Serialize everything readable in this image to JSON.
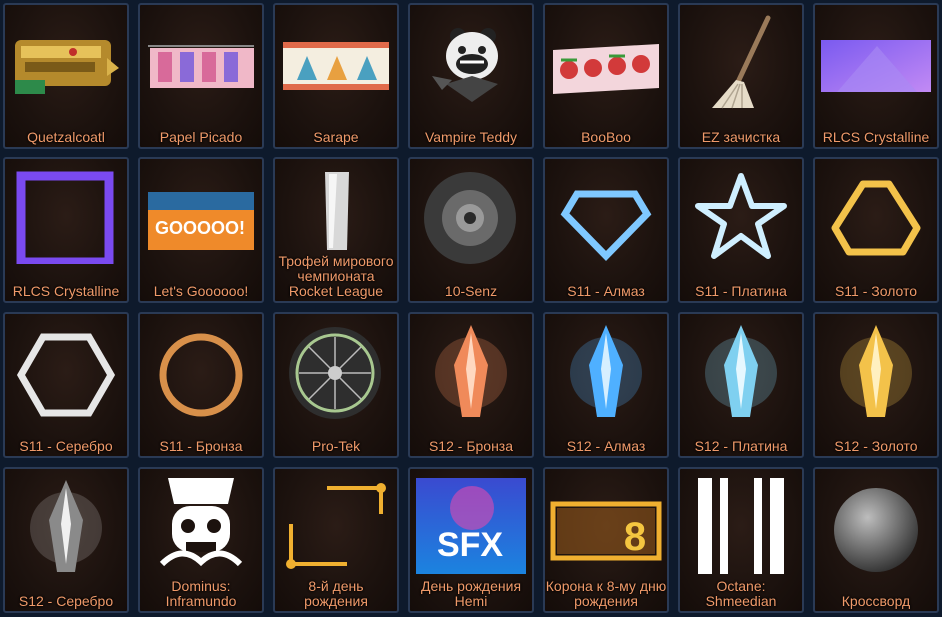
{
  "items": [
    {
      "name": "Quetzalcoatl",
      "icon": "quetzalcoatl-topper-icon"
    },
    {
      "name": "Papel Picado",
      "icon": "papel-picado-flag-icon"
    },
    {
      "name": "Sarape",
      "icon": "sarape-flag-icon"
    },
    {
      "name": "Vampire Teddy",
      "icon": "vampire-teddy-topper-icon"
    },
    {
      "name": "BooBoo",
      "icon": "booboo-banner-icon"
    },
    {
      "name": "EZ зачистка",
      "icon": "broom-icon"
    },
    {
      "name": "RLCS Crystalline",
      "icon": "crystalline-banner-icon"
    },
    {
      "name": "RLCS Crystalline",
      "icon": "crystalline-border-icon"
    },
    {
      "name": "Let's Goooooo!",
      "icon": "lets-go-banner-icon"
    },
    {
      "name": "Трофей мирового чемпионата Rocket League",
      "icon": "trophy-icon"
    },
    {
      "name": "10-Senz",
      "icon": "wheel-icon"
    },
    {
      "name": "S11 - Алмаз",
      "icon": "diamond-rank-icon"
    },
    {
      "name": "S11 - Платина",
      "icon": "star-rank-icon"
    },
    {
      "name": "S11 - Золото",
      "icon": "triangle-rank-icon"
    },
    {
      "name": "S11 - Серебро",
      "icon": "hexagon-rank-icon"
    },
    {
      "name": "S11 - Бронза",
      "icon": "circle-rank-icon"
    },
    {
      "name": "Pro-Tek",
      "icon": "spoke-wheel-icon"
    },
    {
      "name": "S12 - Бронза",
      "icon": "crystal-shard-icon"
    },
    {
      "name": "S12 - Алмаз",
      "icon": "crystal-shard-icon"
    },
    {
      "name": "S12 - Платина",
      "icon": "crystal-shard-icon"
    },
    {
      "name": "S12 - Золото",
      "icon": "crystal-shard-icon"
    },
    {
      "name": "S12 - Серебро",
      "icon": "crystal-shard-icon"
    },
    {
      "name": "Dominus: Inframundo",
      "icon": "skull-decal-icon"
    },
    {
      "name": "8-й день рождения",
      "icon": "ornate-frame-icon"
    },
    {
      "name": "День рождения Hemi",
      "icon": "sfx-banner-icon"
    },
    {
      "name": "Корона к 8-му дню рождения",
      "icon": "crown-eight-banner-icon"
    },
    {
      "name": "Octane: Shmeedian",
      "icon": "stripes-decal-icon"
    },
    {
      "name": "Кроссворд",
      "icon": "paint-sphere-icon"
    }
  ],
  "colors": {
    "label": "#f09a6a",
    "background": "#0e1a2c",
    "tile_border": "#2a3a55",
    "s12_bronze": "#f08a5a",
    "s12_diamond": "#4fb0ff",
    "s12_platinum": "#7fd0f0",
    "s12_gold": "#f3c24a",
    "s12_silver": "#d0d0d0"
  }
}
